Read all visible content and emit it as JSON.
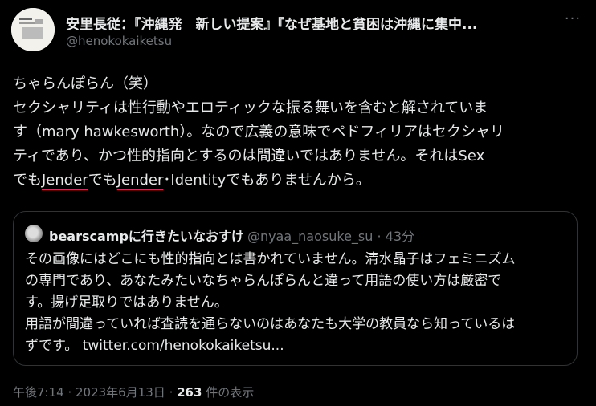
{
  "tweet": {
    "display_name": "安里長従：『沖縄発　新しい提案』『なぜ基地と貧困は沖縄に集中...",
    "handle": "@henokokaiketsu",
    "more_icon": "···",
    "line1": "ちゃらんぽらん（笑）",
    "line2": "セクシャリティは性行動やエロティックな振る舞いを含むと解されていま",
    "line3": "す（mary hawkesworth）。なので広義の意味でペドフィリアはセクシャリ",
    "line4": "ティであり、かつ性的指向とするのは間違いではありません。それはSex",
    "line5_a": "でも",
    "line5_b": "Jender",
    "line5_c": "でも",
    "line5_d": "Jender",
    "line5_e": "･Identityでもありませんから。"
  },
  "quote": {
    "display_name": "bearscampに行きたいなおすけ",
    "handle": "@nyaa_naosuke_su",
    "separator": " · ",
    "time": "43分",
    "line1": "その画像にはどこにも性的指向とは書かれていません。清水晶子はフェミニズム",
    "line2": "の専門であり、あなたみたいなちゃらんぽらんと違って用語の使い方は厳密で",
    "line3": "す。揚げ足取りではありません。",
    "line4": "用語が間違っていれば査読を通らないのはあなたも大学の教員なら知っているは",
    "line5": "ずです。 twitter.com/henokokaiketsu..."
  },
  "meta": {
    "time": "午後7:14",
    "sep1": " · ",
    "date": "2023年6月13日",
    "sep2": " · ",
    "views": "263",
    "views_label": " 件の表示"
  },
  "colors": {
    "background": "#000000",
    "text": "#e7e9ea",
    "secondary": "#71767b",
    "border": "#2f3336",
    "underline_annotation": "#e0245e"
  }
}
